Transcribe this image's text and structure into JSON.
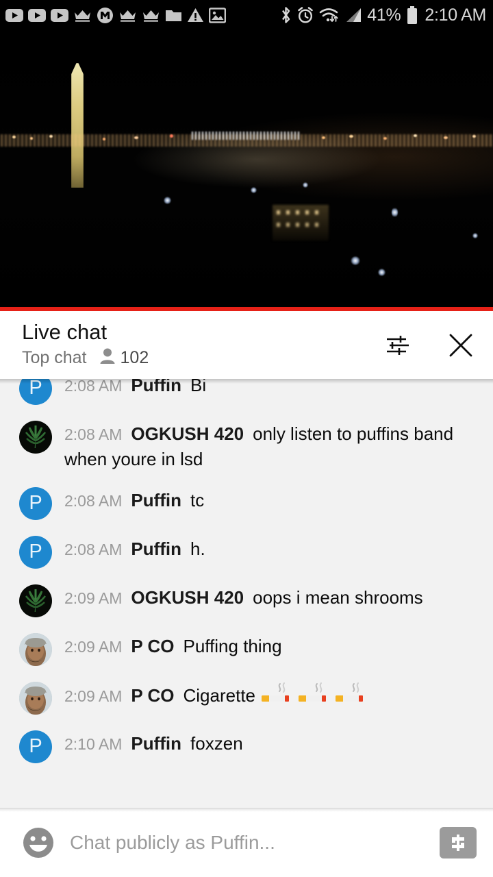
{
  "status_bar": {
    "left_icons": [
      {
        "name": "youtube-icon-1",
        "label": "YouTube"
      },
      {
        "name": "youtube-icon-2",
        "label": "YouTube"
      },
      {
        "name": "youtube-icon-3",
        "label": "YouTube"
      },
      {
        "name": "crown-icon-1",
        "label": "Crown"
      },
      {
        "name": "mega-icon",
        "label": "M"
      },
      {
        "name": "crown-icon-2",
        "label": "Crown"
      },
      {
        "name": "crown-icon-3",
        "label": "Crown"
      },
      {
        "name": "folder-icon",
        "label": "Folder"
      },
      {
        "name": "warning-icon",
        "label": "Warning"
      },
      {
        "name": "image-icon",
        "label": "Image"
      }
    ],
    "right_icons": [
      {
        "name": "bluetooth-icon",
        "label": "Bluetooth"
      },
      {
        "name": "alarm-icon",
        "label": "Alarm"
      },
      {
        "name": "wifi-icon",
        "label": "Wi-Fi"
      },
      {
        "name": "signal-icon",
        "label": "Signal"
      }
    ],
    "battery_percent": "41%",
    "clock": "2:10 AM"
  },
  "video": {
    "scene": "Washington DC skyline at night with Washington Monument",
    "progress_color": "#e62117"
  },
  "chat_header": {
    "title": "Live chat",
    "mode": "Top chat",
    "viewer_count": "102",
    "filter_icon": "tune-icon",
    "close_icon": "close-icon"
  },
  "messages": [
    {
      "avatar": "puffin",
      "avatar_glyph": "P",
      "time": "2:08 AM",
      "author": "Puffin",
      "text": "Bi",
      "clipped": true
    },
    {
      "avatar": "leaf",
      "avatar_glyph": "",
      "time": "2:08 AM",
      "author": "OGKUSH 420",
      "text": "only listen to puffins band when youre in lsd",
      "clipped": false
    },
    {
      "avatar": "puffin",
      "avatar_glyph": "P",
      "time": "2:08 AM",
      "author": "Puffin",
      "text": "tc",
      "clipped": false
    },
    {
      "avatar": "puffin",
      "avatar_glyph": "P",
      "time": "2:08 AM",
      "author": "Puffin",
      "text": "h.",
      "clipped": false
    },
    {
      "avatar": "leaf",
      "avatar_glyph": "",
      "time": "2:09 AM",
      "author": "OGKUSH 420",
      "text": "oops i mean shrooms",
      "clipped": false
    },
    {
      "avatar": "photo",
      "avatar_glyph": "",
      "time": "2:09 AM",
      "author": "P CO",
      "text": "Puffing thing",
      "clipped": false
    },
    {
      "avatar": "photo",
      "avatar_glyph": "",
      "time": "2:09 AM",
      "author": "P CO",
      "text": "Cigarette",
      "emoji": "cigarette",
      "emoji_count": 3,
      "clipped": false
    },
    {
      "avatar": "puffin",
      "avatar_glyph": "P",
      "time": "2:10 AM",
      "author": "Puffin",
      "text": "foxzen",
      "clipped": false
    }
  ],
  "input_bar": {
    "emoji_icon": "emoji-smiley-icon",
    "placeholder": "Chat publicly as Puffin...",
    "value": "",
    "superchat_icon": "dollar-icon"
  },
  "colors": {
    "accent_red": "#e62117",
    "avatar_blue": "#1e88cf",
    "chat_bg": "#f2f2f2",
    "status_bar_bg": "#000000"
  }
}
